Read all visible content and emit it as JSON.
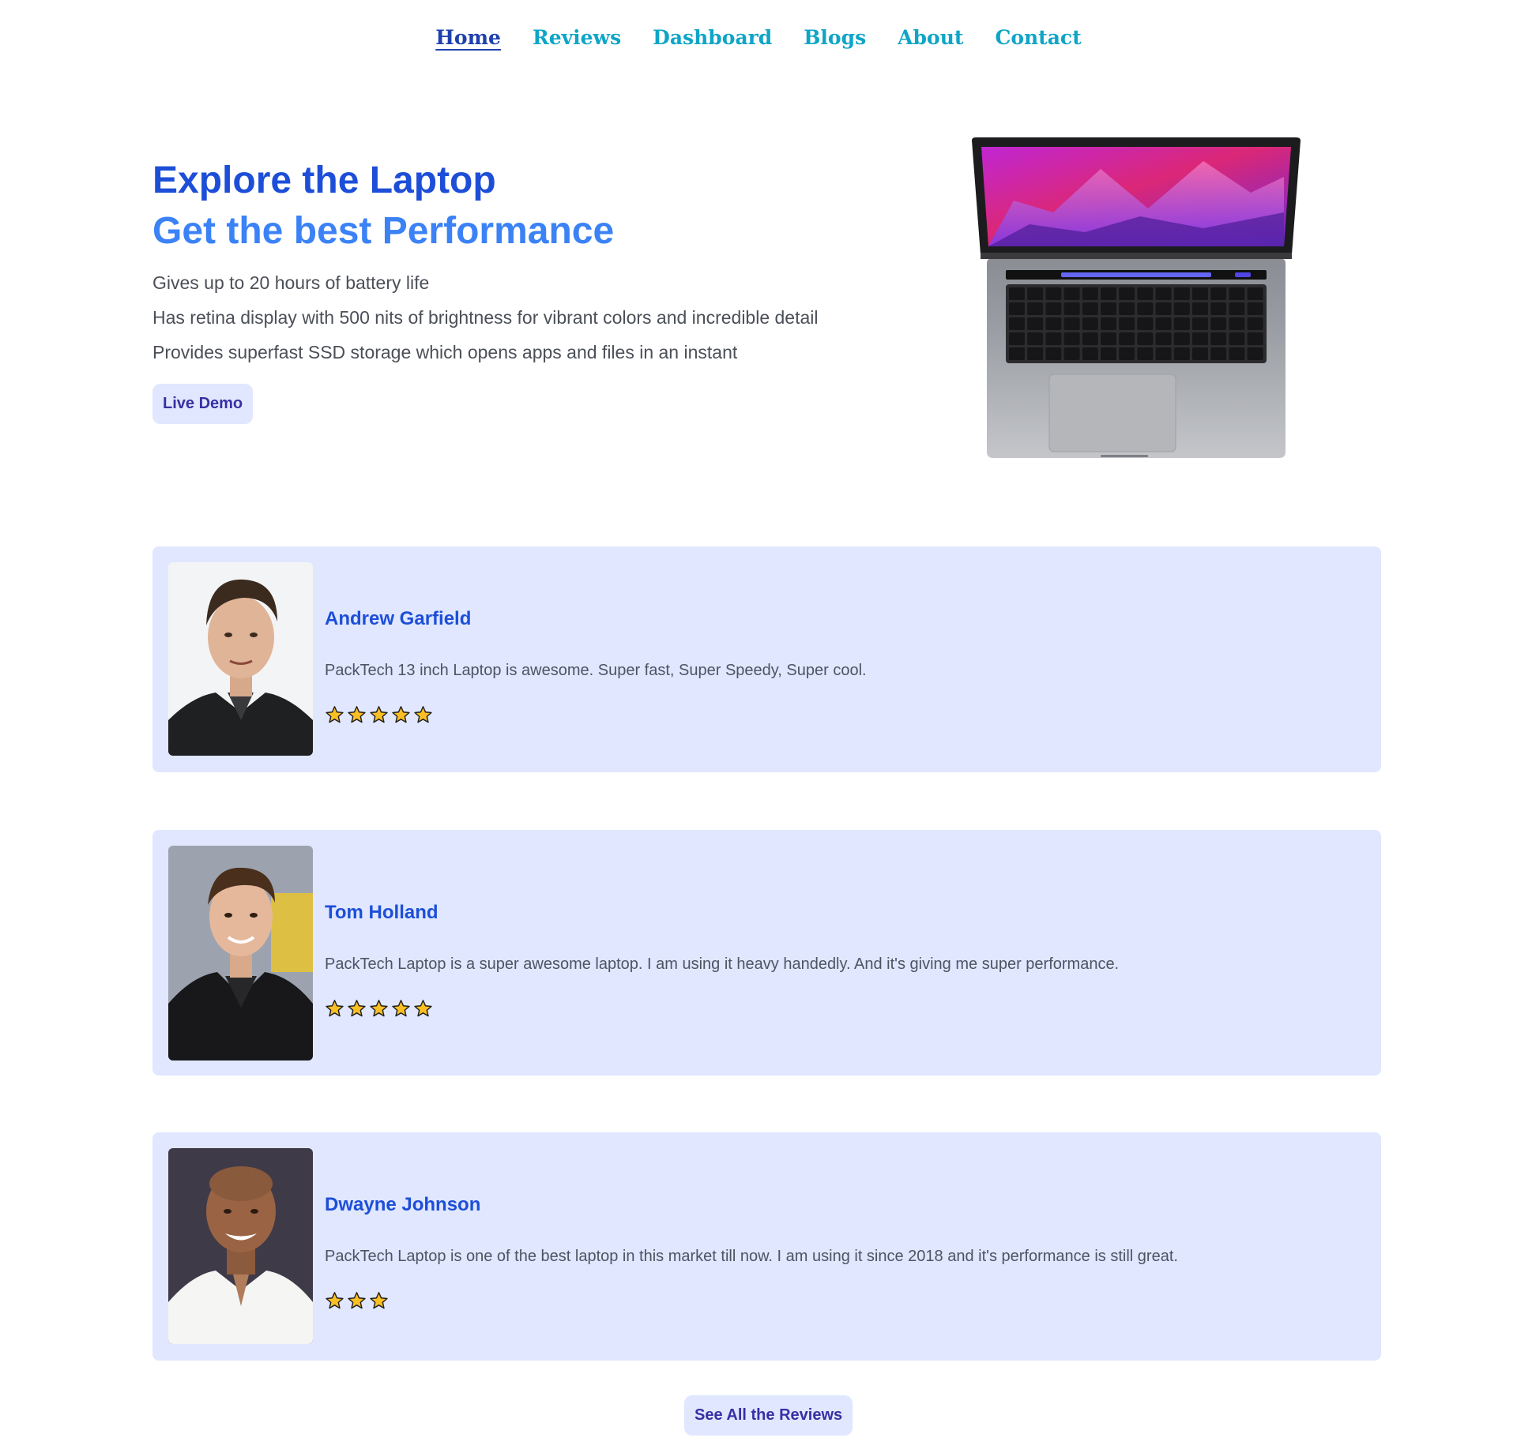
{
  "nav": {
    "items": [
      {
        "label": "Home",
        "active": true
      },
      {
        "label": "Reviews",
        "active": false
      },
      {
        "label": "Dashboard",
        "active": false
      },
      {
        "label": "Blogs",
        "active": false
      },
      {
        "label": "About",
        "active": false
      },
      {
        "label": "Contact",
        "active": false
      }
    ]
  },
  "hero": {
    "title": "Explore the Laptop",
    "subtitle": "Get the best Performance",
    "features": [
      "Gives up to 20 hours of battery life",
      "Has retina display with 500 nits of brightness for vibrant colors and incredible detail",
      "Provides superfast SSD storage which opens apps and files in an instant"
    ],
    "button_label": "Live Demo"
  },
  "reviews": [
    {
      "name": "Andrew Garfield",
      "text": "PackTech 13 inch Laptop is awesome. Super fast, Super Speedy, Super cool.",
      "rating": 5
    },
    {
      "name": "Tom Holland",
      "text": "PackTech Laptop is a super awesome laptop. I am using it heavy handedly. And it's giving me super performance.",
      "rating": 5
    },
    {
      "name": "Dwayne Johnson",
      "text": "PackTech Laptop is one of the best laptop in this market till now. I am using it since 2018 and it's performance is still great.",
      "rating": 3
    }
  ],
  "see_all_label": "See All the Reviews",
  "colors": {
    "nav_link": "#0ea5c7",
    "nav_active": "#1e40af",
    "title": "#1d4ed8",
    "subtitle": "#3b82f6",
    "card_bg": "#e0e7ff",
    "button_text": "#3730a3",
    "star_fill": "#fbbf24"
  }
}
